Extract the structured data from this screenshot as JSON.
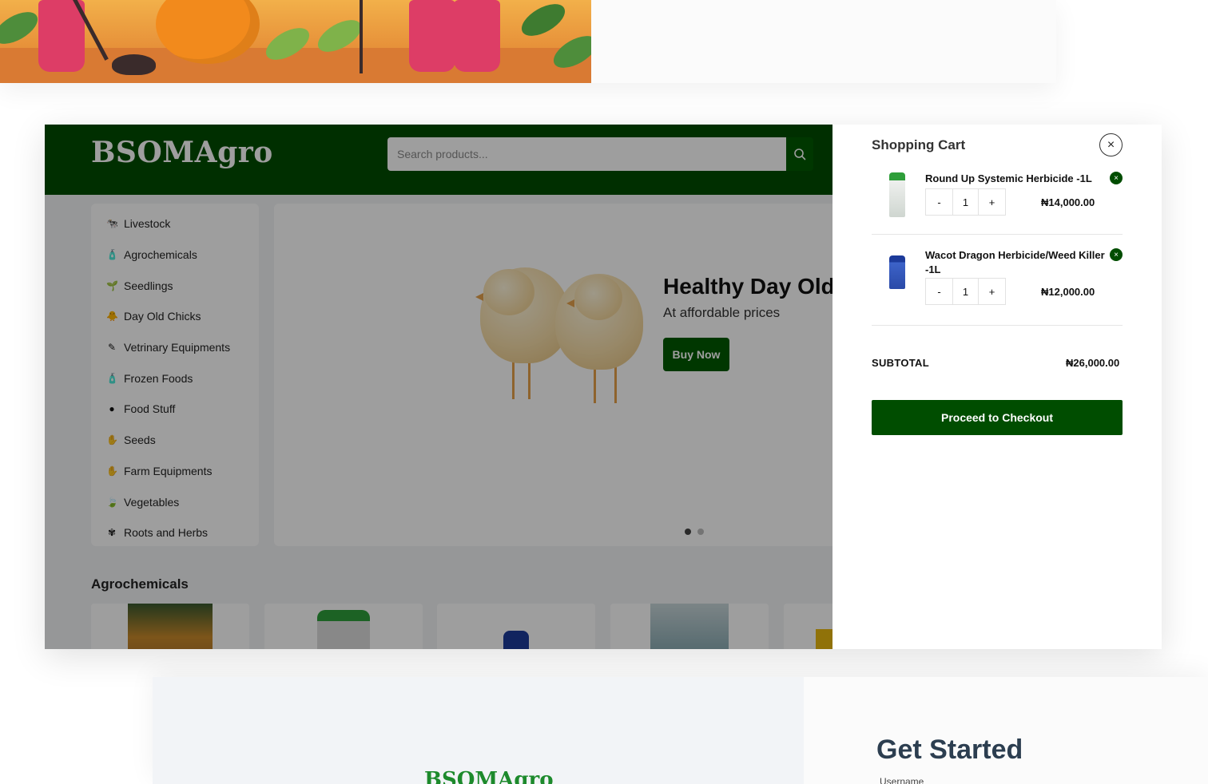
{
  "site": {
    "logo": "BSOMAgro",
    "search_placeholder": "Search products..."
  },
  "sidebar": {
    "items": [
      {
        "label": "Livestock",
        "icon": "livestock-icon",
        "glyph": "🐄"
      },
      {
        "label": "Agrochemicals",
        "icon": "bottle-icon",
        "glyph": "🧴"
      },
      {
        "label": "Seedlings",
        "icon": "seedling-icon",
        "glyph": "🌱"
      },
      {
        "label": "Day Old Chicks",
        "icon": "chick-icon",
        "glyph": "🐥"
      },
      {
        "label": "Vetrinary Equipments",
        "icon": "syringe-icon",
        "glyph": "✎"
      },
      {
        "label": "Frozen Foods",
        "icon": "bottle-icon",
        "glyph": "🧴"
      },
      {
        "label": "Food Stuff",
        "icon": "bowl-icon",
        "glyph": "●"
      },
      {
        "label": "Seeds",
        "icon": "seed-hand-icon",
        "glyph": "✋"
      },
      {
        "label": "Farm Equipments",
        "icon": "seed-hand-icon",
        "glyph": "✋"
      },
      {
        "label": "Vegetables",
        "icon": "leaf-icon",
        "glyph": "🍃"
      },
      {
        "label": "Roots and Herbs",
        "icon": "herb-icon",
        "glyph": "✾"
      }
    ]
  },
  "hero": {
    "title": "Healthy Day Old",
    "subtitle": "At affordable prices",
    "button": "Buy Now"
  },
  "section": {
    "title": "Agrochemicals"
  },
  "cart": {
    "title": "Shopping Cart",
    "close": "×",
    "items": [
      {
        "name": "Round Up Systemic Herbicide -1L",
        "qty": "1",
        "price": "₦14,000.00",
        "minus": "-",
        "plus": "+",
        "remove": "×"
      },
      {
        "name": "Wacot Dragon Herbicide/Weed Killer -1L",
        "qty": "1",
        "price": "₦12,000.00",
        "minus": "-",
        "plus": "+",
        "remove": "×"
      }
    ],
    "subtotal_label": "SUBTOTAL",
    "subtotal_value": "₦26,000.00",
    "checkout": "Proceed to Checkout"
  },
  "login": {
    "logo": "BSOMAgro",
    "heading": "Get Started",
    "username_label": "Username"
  },
  "colors": {
    "brand_green": "#004d00",
    "accent_green": "#005a00"
  }
}
